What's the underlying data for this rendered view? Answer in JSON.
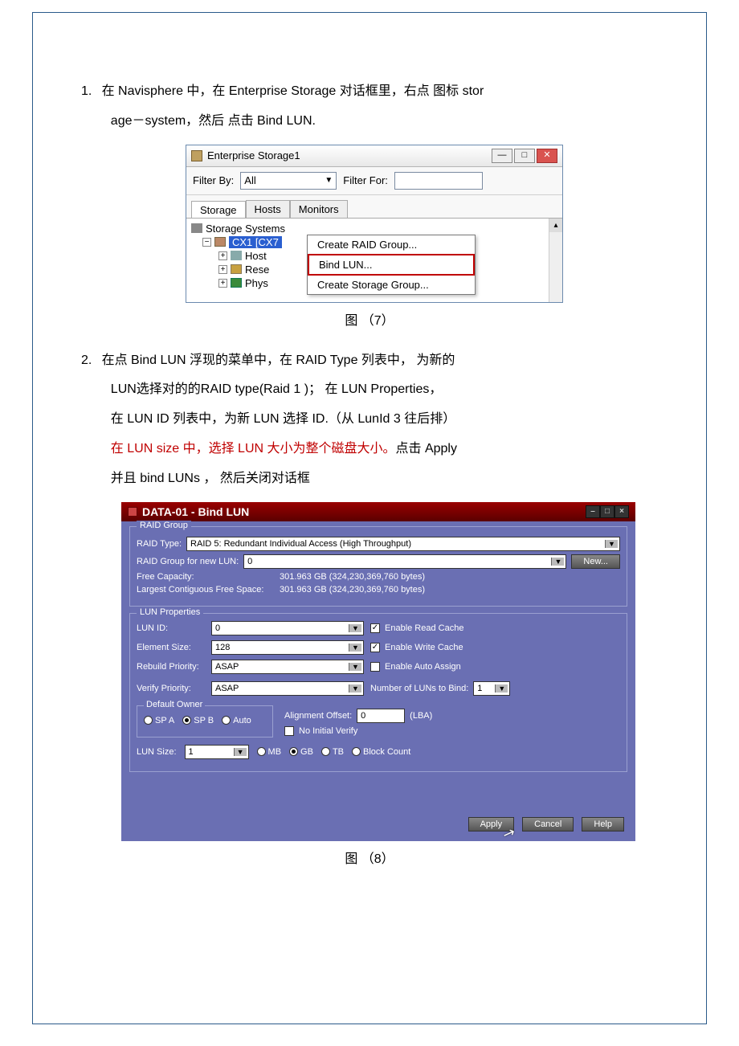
{
  "steps": {
    "s1": {
      "num": "1.",
      "text_a": "在 Navisphere 中，在 Enterprise Storage 对话框里，右点 图标  stor",
      "text_b": "age－system，然后 点击  Bind LUN."
    },
    "s2": {
      "num": "2.",
      "line1": "在点 Bind LUN 浮现的菜单中，在 RAID Type 列表中， 为新的",
      "line2": "LUN选择对的的RAID  type(Raid 1  )；  在 LUN Properties，",
      "line3": "在 LUN  ID  列表中，为新 LUN 选择 ID.（从 LunId 3 往后排）",
      "line4_red": "在 LUN  size 中，选择 LUN 大小为整个磁盘大小。",
      "line4_tail": "点击 Apply",
      "line5": "并且 bind  LUNs ，  然后关闭对话框"
    }
  },
  "captions": {
    "c7": "图 （7）",
    "c8": "图 （8）"
  },
  "es": {
    "title": "Enterprise Storage1",
    "filter_by": "Filter By:",
    "filter_all": "All",
    "filter_for": "Filter For:",
    "tabs": {
      "storage": "Storage",
      "hosts": "Hosts",
      "monitors": "Monitors"
    },
    "tree": {
      "root": "Storage Systems",
      "array": "CX1 [CX7",
      "host": "Host",
      "rese": "Rese",
      "phys": "Phys"
    },
    "menu": {
      "create_rg": "Create RAID Group...",
      "bind_lun": "Bind LUN...",
      "create_sg": "Create Storage Group..."
    },
    "winbtns": {
      "min": "—",
      "max": "□",
      "close": "✕"
    }
  },
  "bl": {
    "title": "DATA-01 - Bind LUN",
    "winbtns": {
      "min": "–",
      "max": "□",
      "close": "×"
    },
    "raid_group_legend": "RAID Group",
    "raid_type_lbl": "RAID Type:",
    "raid_type_val": "RAID 5: Redundant Individual Access (High Throughput)",
    "rg_new_lbl": "RAID Group for new LUN:",
    "rg_new_val": "0",
    "new_btn": "New...",
    "free_cap_lbl": "Free Capacity:",
    "free_cap_val": "301.963 GB  (324,230,369,760 bytes)",
    "lcfs_lbl": "Largest Contiguous Free Space:",
    "lcfs_val": "301.963 GB  (324,230,369,760 bytes)",
    "lun_props_legend": "LUN Properties",
    "lun_id_lbl": "LUN ID:",
    "lun_id_val": "0",
    "elem_size_lbl": "Element Size:",
    "elem_size_val": "128",
    "rebuild_lbl": "Rebuild Priority:",
    "rebuild_val": "ASAP",
    "verify_lbl": "Verify Priority:",
    "verify_val": "ASAP",
    "enable_read": "Enable Read Cache",
    "enable_write": "Enable Write Cache",
    "enable_auto": "Enable Auto Assign",
    "num_luns_lbl": "Number of LUNs to Bind:",
    "num_luns_val": "1",
    "default_owner_legend": "Default Owner",
    "spa": "SP A",
    "spb": "SP B",
    "auto": "Auto",
    "align_lbl": "Alignment Offset:",
    "align_val": "0",
    "align_unit": "(LBA)",
    "no_init": "No Initial Verify",
    "lun_size_lbl": "LUN Size:",
    "lun_size_val": "1",
    "unit_mb": "MB",
    "unit_gb": "GB",
    "unit_tb": "TB",
    "unit_bc": "Block Count",
    "apply": "Apply",
    "cancel": "Cancel",
    "help": "Help"
  }
}
